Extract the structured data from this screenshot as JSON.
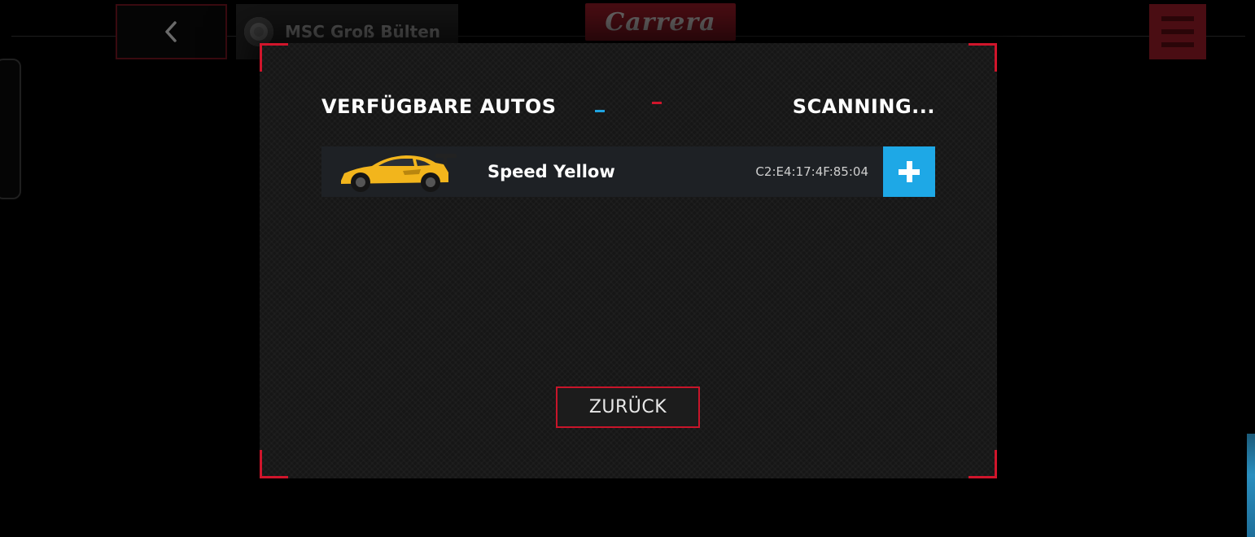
{
  "header": {
    "back_icon": "chevron-left-icon",
    "track_name": "MSC Groß Bülten",
    "logo_text": "Carrera",
    "menu_icon": "hamburger-menu-icon"
  },
  "dialog": {
    "title": "VERFÜGBARE AUTOS",
    "status": "SCANNING...",
    "cars": [
      {
        "name": "Speed Yellow",
        "mac": "C2:E4:17:4F:85:04",
        "add_icon": "plus-icon"
      }
    ],
    "back_label": "ZURÜCK"
  },
  "colors": {
    "accent_red": "#d0152b",
    "accent_blue": "#1ea8e6",
    "car_yellow": "#f2b51c"
  }
}
